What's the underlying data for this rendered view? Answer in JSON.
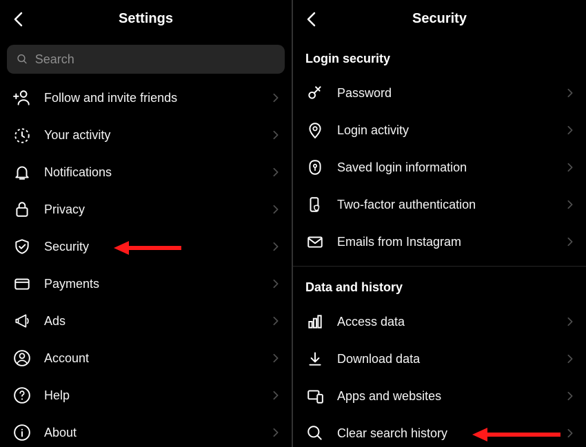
{
  "left": {
    "title": "Settings",
    "search_placeholder": "Search",
    "items": [
      {
        "label": "Follow and invite friends"
      },
      {
        "label": "Your activity"
      },
      {
        "label": "Notifications"
      },
      {
        "label": "Privacy"
      },
      {
        "label": "Security"
      },
      {
        "label": "Payments"
      },
      {
        "label": "Ads"
      },
      {
        "label": "Account"
      },
      {
        "label": "Help"
      },
      {
        "label": "About"
      }
    ]
  },
  "right": {
    "title": "Security",
    "section1_title": "Login security",
    "section1_items": [
      {
        "label": "Password"
      },
      {
        "label": "Login activity"
      },
      {
        "label": "Saved login information"
      },
      {
        "label": "Two-factor authentication"
      },
      {
        "label": "Emails from Instagram"
      }
    ],
    "section2_title": "Data and history",
    "section2_items": [
      {
        "label": "Access data"
      },
      {
        "label": "Download data"
      },
      {
        "label": "Apps and websites"
      },
      {
        "label": "Clear search history"
      }
    ]
  }
}
